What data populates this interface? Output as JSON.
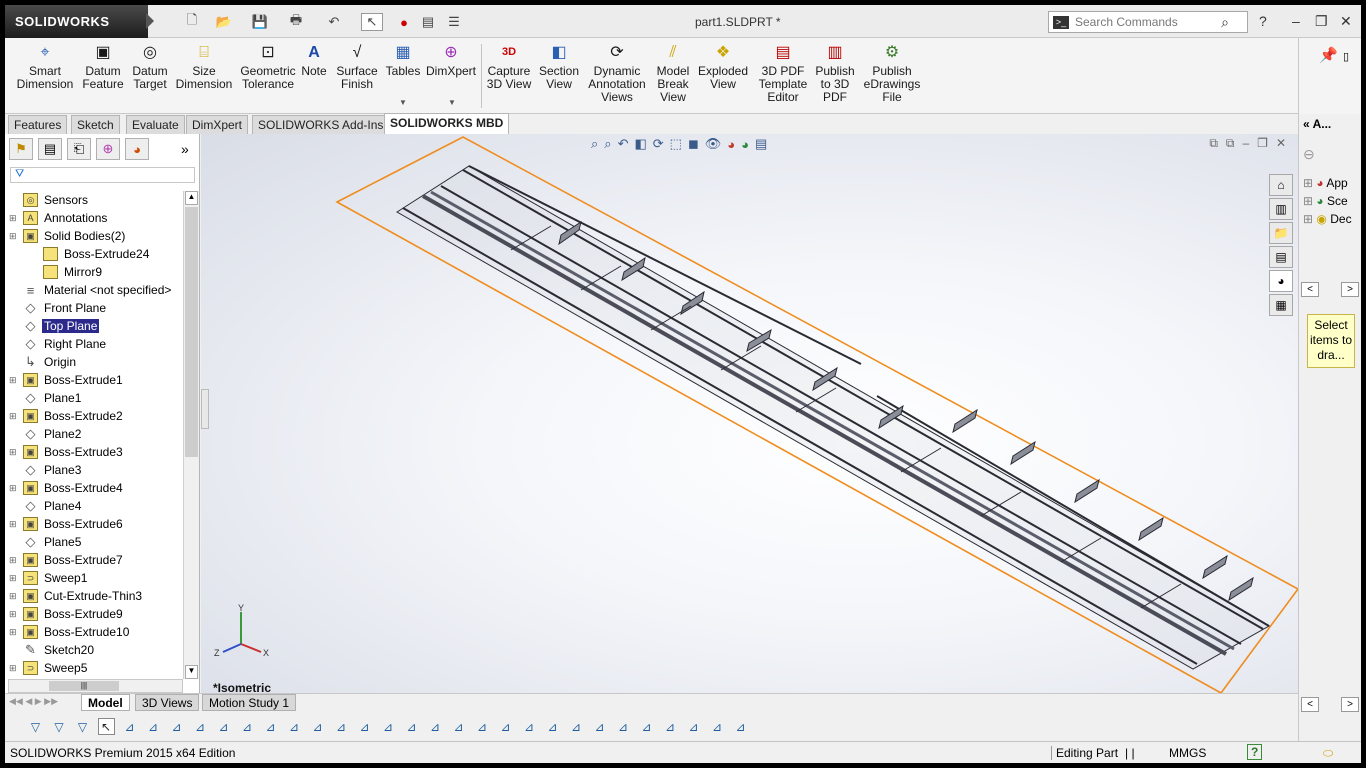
{
  "app": {
    "logo_text": "SOLIDWORKS",
    "document_title": "part1.SLDPRT *",
    "search_placeholder": "Search Commands"
  },
  "command_manager": {
    "buttons": [
      {
        "label": "Smart Dimension",
        "icon": "smart-dimension-icon"
      },
      {
        "label": "Datum Feature",
        "icon": "datum-feature-icon"
      },
      {
        "label": "Datum Target",
        "icon": "datum-target-icon"
      },
      {
        "label": "Size Dimension",
        "icon": "size-dimension-icon"
      },
      {
        "label": "Geometric Tolerance",
        "icon": "geometric-tolerance-icon"
      },
      {
        "label": "Note",
        "icon": "note-icon"
      },
      {
        "label": "Surface Finish",
        "icon": "surface-finish-icon"
      },
      {
        "label": "Tables",
        "icon": "tables-icon"
      },
      {
        "label": "DimXpert",
        "icon": "dimxpert-icon"
      },
      {
        "label": "Capture 3D View",
        "icon": "capture-3d-view-icon"
      },
      {
        "label": "Section View",
        "icon": "section-view-icon"
      },
      {
        "label": "Dynamic Annotation Views",
        "icon": "dynamic-annotation-icon"
      },
      {
        "label": "Model Break View",
        "icon": "model-break-icon"
      },
      {
        "label": "Exploded View",
        "icon": "exploded-view-icon"
      },
      {
        "label": "3D PDF Template Editor",
        "icon": "pdf-template-icon"
      },
      {
        "label": "Publish to 3D PDF",
        "icon": "publish-pdf-icon"
      },
      {
        "label": "Publish eDrawings File",
        "icon": "edrawings-icon"
      }
    ]
  },
  "tabs": [
    "Features",
    "Sketch",
    "Evaluate",
    "DimXpert",
    "SOLIDWORKS Add-Ins",
    "SOLIDWORKS MBD"
  ],
  "active_tab": "SOLIDWORKS MBD",
  "feature_tree": [
    {
      "label": "Sensors",
      "expand": false,
      "icon": "sensor-icon"
    },
    {
      "label": "Annotations",
      "expand": true,
      "icon": "annotation-icon"
    },
    {
      "label": "Solid Bodies(2)",
      "expand": true,
      "icon": "solid-bodies-icon"
    },
    {
      "label": "Boss-Extrude24",
      "expand": false,
      "icon": "body-icon",
      "indent": 1
    },
    {
      "label": "Mirror9",
      "expand": false,
      "icon": "body-icon",
      "indent": 1
    },
    {
      "label": "Material <not specified>",
      "expand": false,
      "icon": "material-icon"
    },
    {
      "label": "Front Plane",
      "expand": false,
      "icon": "plane-icon"
    },
    {
      "label": "Top Plane",
      "expand": false,
      "icon": "plane-icon",
      "selected": true
    },
    {
      "label": "Right Plane",
      "expand": false,
      "icon": "plane-icon"
    },
    {
      "label": "Origin",
      "expand": false,
      "icon": "origin-icon"
    },
    {
      "label": "Boss-Extrude1",
      "expand": true,
      "icon": "extrude-icon"
    },
    {
      "label": "Plane1",
      "expand": false,
      "icon": "plane-icon"
    },
    {
      "label": "Boss-Extrude2",
      "expand": true,
      "icon": "extrude-icon"
    },
    {
      "label": "Plane2",
      "expand": false,
      "icon": "plane-icon"
    },
    {
      "label": "Boss-Extrude3",
      "expand": true,
      "icon": "extrude-icon"
    },
    {
      "label": "Plane3",
      "expand": false,
      "icon": "plane-icon"
    },
    {
      "label": "Boss-Extrude4",
      "expand": true,
      "icon": "extrude-icon"
    },
    {
      "label": "Plane4",
      "expand": false,
      "icon": "plane-icon"
    },
    {
      "label": "Boss-Extrude6",
      "expand": true,
      "icon": "extrude-icon"
    },
    {
      "label": "Plane5",
      "expand": false,
      "icon": "plane-icon"
    },
    {
      "label": "Boss-Extrude7",
      "expand": true,
      "icon": "extrude-icon"
    },
    {
      "label": "Sweep1",
      "expand": true,
      "icon": "sweep-icon"
    },
    {
      "label": "Cut-Extrude-Thin3",
      "expand": true,
      "icon": "cut-extrude-icon"
    },
    {
      "label": "Boss-Extrude9",
      "expand": true,
      "icon": "extrude-icon"
    },
    {
      "label": "Boss-Extrude10",
      "expand": true,
      "icon": "extrude-icon"
    },
    {
      "label": "Sketch20",
      "expand": false,
      "icon": "sketch-icon"
    },
    {
      "label": "Sweep5",
      "expand": true,
      "icon": "sweep-icon"
    }
  ],
  "graphics": {
    "view_label": "*Isometric",
    "triad": {
      "x": "X",
      "y": "Y",
      "z": "Z"
    }
  },
  "bottom_tabs": [
    "Model",
    "3D Views",
    "Motion Study 1"
  ],
  "active_bottom_tab": "Model",
  "status_bar": {
    "edition": "SOLIDWORKS Premium 2015 x64 Edition",
    "mode": "Editing Part",
    "units": "MMGS",
    "help": "?"
  },
  "task_pane": {
    "header": "A...",
    "items": [
      "App",
      "Sce",
      "Dec"
    ],
    "tip": "Select items to dra..."
  },
  "colors": {
    "selection": "#2b2a8c",
    "bounding_box": "#f08c1e",
    "model_edge": "#2a2a33"
  }
}
